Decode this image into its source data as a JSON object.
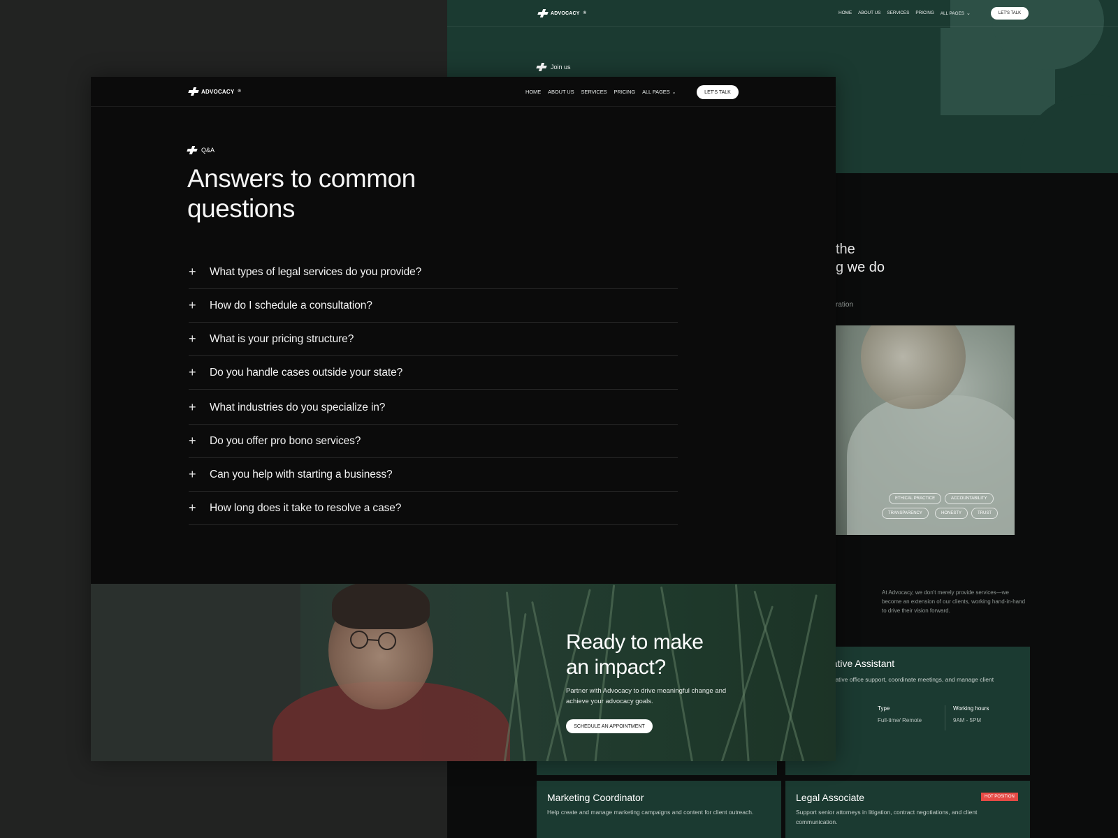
{
  "back": {
    "nav": {
      "logo": "ADVOCACY",
      "logo_mark": "®",
      "links": [
        "HOME",
        "ABOUT US",
        "SERVICES",
        "PRICING",
        "ALL PAGES"
      ],
      "cta": "LET'S TALK"
    },
    "join_label": "Join us",
    "heading_line1": "the",
    "heading_line2": "g we do",
    "sub_label": "ration",
    "photo_tags": [
      "ETHICAL PRACTICE",
      "ACCOUNTABILITY",
      "TRANSPARENCY",
      "HONESTY",
      "TRUST"
    ],
    "intro_text": "At Advocacy, we don't merely provide services—we become an extension of our clients, working hand-in-hand to drive their vision forward.",
    "jobs": [
      {
        "title": "rative Assistant",
        "desc": "strative office support, coordinate meetings, and manage client",
        "type_label": "Type",
        "type_value": "Full-time/ Remote",
        "hours_label": "Working hours",
        "hours_value": "9AM - 5PM"
      },
      {
        "title": "Marketing Coordinator",
        "desc": "Help create and manage marketing campaigns and content for client outreach."
      },
      {
        "title": "Legal Associate",
        "badge": "HOT POSITION",
        "desc": "Support senior attorneys in litigation, contract negotiations, and client communication."
      }
    ]
  },
  "front": {
    "nav": {
      "logo": "ADVOCACY",
      "logo_mark": "®",
      "links": [
        "HOME",
        "ABOUT US",
        "SERVICES",
        "PRICING",
        "ALL PAGES"
      ],
      "cta": "LET'S TALK"
    },
    "section_label": "Q&A",
    "heading_line1": "Answers to common",
    "heading_line2": "questions",
    "faq": [
      "What types of legal services do you provide?",
      "How do I schedule a consultation?",
      "What is your pricing structure?",
      "Do you handle cases outside your state?",
      "What industries do you specialize in?",
      "Do you offer pro bono services?",
      "Can you help with starting a business?",
      "How long does it take to resolve a case?"
    ],
    "cta": {
      "heading_line1": "Ready to make",
      "heading_line2": "an impact?",
      "body": "Partner with Advocacy to drive meaningful change and achieve your advocacy goals.",
      "button": "SCHEDULE AN APPOINTMENT"
    }
  },
  "colors": {
    "background": "#222322",
    "page": "#0b0b0b",
    "brand_green": "#1b3a31",
    "accent_green": "#2d5046",
    "hot_badge": "#e54a45"
  }
}
